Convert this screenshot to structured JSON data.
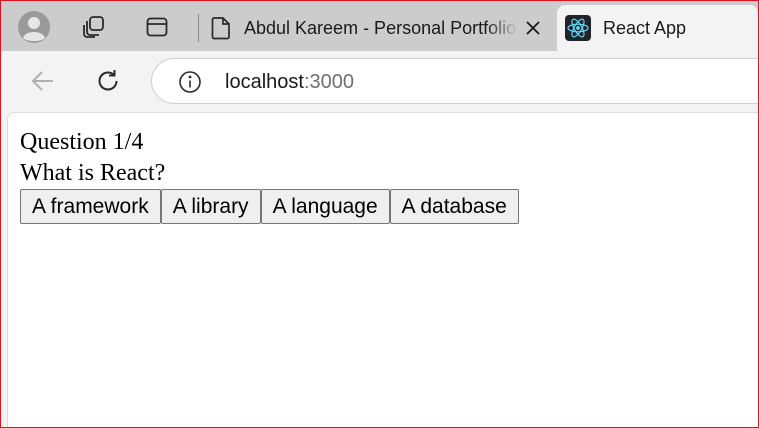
{
  "browser": {
    "tabs": [
      {
        "title": "Abdul Kareem - Personal Portfolio",
        "active": false
      },
      {
        "title": "React App",
        "active": true
      }
    ],
    "address": {
      "host": "localhost",
      "port": ":3000"
    }
  },
  "quiz": {
    "progress": "Question 1/4",
    "question": "What is React?",
    "answers": [
      "A framework",
      "A library",
      "A language",
      "A database"
    ]
  },
  "colors": {
    "frame_border": "#e0141e",
    "tabstrip": "#cccccc",
    "toolbar": "#f3f3f3",
    "button_bg": "#efefef",
    "button_border": "#767676",
    "react_logo": "#61dafb"
  },
  "icons": {
    "profile": "profile-avatar-icon",
    "workspaces": "workspaces-icon",
    "tab_actions": "tab-actions-icon",
    "page": "page-icon",
    "close": "close-icon",
    "react": "react-logo-icon",
    "back": "back-arrow-icon",
    "reload": "reload-icon",
    "info": "info-icon"
  }
}
